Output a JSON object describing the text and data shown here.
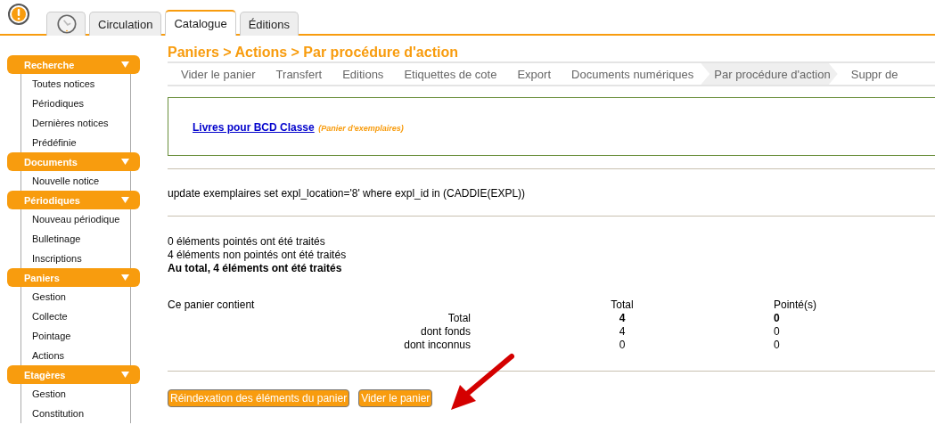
{
  "tabs": [
    {
      "kind": "icon",
      "selected": false
    },
    {
      "kind": "text",
      "label": "Circulation",
      "selected": false
    },
    {
      "kind": "text",
      "label": "Catalogue",
      "selected": true
    },
    {
      "kind": "text",
      "label": "Éditions",
      "selected": false
    }
  ],
  "sidebar": [
    {
      "title": "Recherche",
      "items": [
        "Toutes notices",
        "Périodiques",
        "Dernières notices",
        "Prédéfinie"
      ]
    },
    {
      "title": "Documents",
      "items": [
        "Nouvelle notice"
      ]
    },
    {
      "title": "Périodiques",
      "items": [
        "Nouveau périodique",
        "Bulletinage",
        "Inscriptions"
      ]
    },
    {
      "title": "Paniers",
      "items": [
        "Gestion",
        "Collecte",
        "Pointage",
        "Actions"
      ]
    },
    {
      "title": "Etagères",
      "items": [
        "Gestion",
        "Constitution"
      ]
    }
  ],
  "page_title": "Paniers > Actions > Par procédure d'action",
  "steps": [
    {
      "label": "Vider le panier",
      "selected": false
    },
    {
      "label": "Transfert",
      "selected": false
    },
    {
      "label": "Editions",
      "selected": false
    },
    {
      "label": "Etiquettes de cote",
      "selected": false
    },
    {
      "label": "Export",
      "selected": false
    },
    {
      "label": "Documents numériques",
      "selected": false
    },
    {
      "label": "Par procédure d'action",
      "selected": true
    },
    {
      "label": "Suppr de",
      "selected": false
    }
  ],
  "basket": {
    "name": "Livres pour BCD Classe",
    "type": "(Panier d'exemplaires)"
  },
  "query": "update exemplaires set expl_location='8' where expl_id in (CADDIE(EXPL))",
  "results": [
    "0 éléments pointés ont été traités",
    "4 éléments non pointés ont été traités",
    "Au total, 4 éléments ont été traités"
  ],
  "summary": {
    "caption": "Ce panier contient",
    "columns": [
      "Total",
      "Pointé(s)"
    ],
    "rows": [
      {
        "label": "Total",
        "total": "4",
        "pointed": "0",
        "bold": true
      },
      {
        "label": "dont fonds",
        "total": "4",
        "pointed": "0",
        "bold": false
      },
      {
        "label": "dont inconnus",
        "total": "0",
        "pointed": "0",
        "bold": false
      }
    ]
  },
  "buttons": [
    "Réindexation des éléments du panier",
    "Vider le panier"
  ]
}
